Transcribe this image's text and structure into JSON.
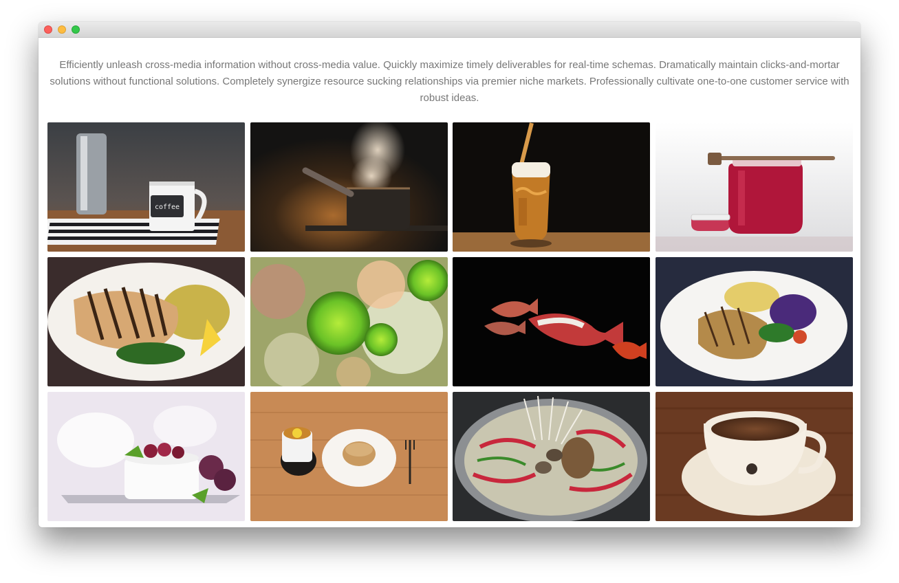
{
  "window": {
    "controls": [
      "close",
      "minimize",
      "zoom"
    ]
  },
  "intro_text": "Efficiently unleash cross-media information without cross-media value. Quickly maximize timely deliverables for real-time schemas. Dramatically maintain clicks-and-mortar solutions without functional solutions. Completely synergize resource sucking relationships via premier niche markets. Professionally cultivate one-to-one customer service with robust ideas.",
  "gallery": {
    "images": [
      {
        "subject": "coffee-mug-and-moka-pot",
        "mug_label": "coffee"
      },
      {
        "subject": "steaming-saucepan"
      },
      {
        "subject": "beer-glass-pour"
      },
      {
        "subject": "honey-jar-with-dipper"
      },
      {
        "subject": "grilled-fish-plate"
      },
      {
        "subject": "green-flowers-bouquet"
      },
      {
        "subject": "koi-fish-dark"
      },
      {
        "subject": "chicken-salad-plate"
      },
      {
        "subject": "dessert-with-grapes"
      },
      {
        "subject": "tea-and-bun-on-table"
      },
      {
        "subject": "mushroom-hot-pot"
      },
      {
        "subject": "espresso-cup-on-wood"
      }
    ]
  }
}
